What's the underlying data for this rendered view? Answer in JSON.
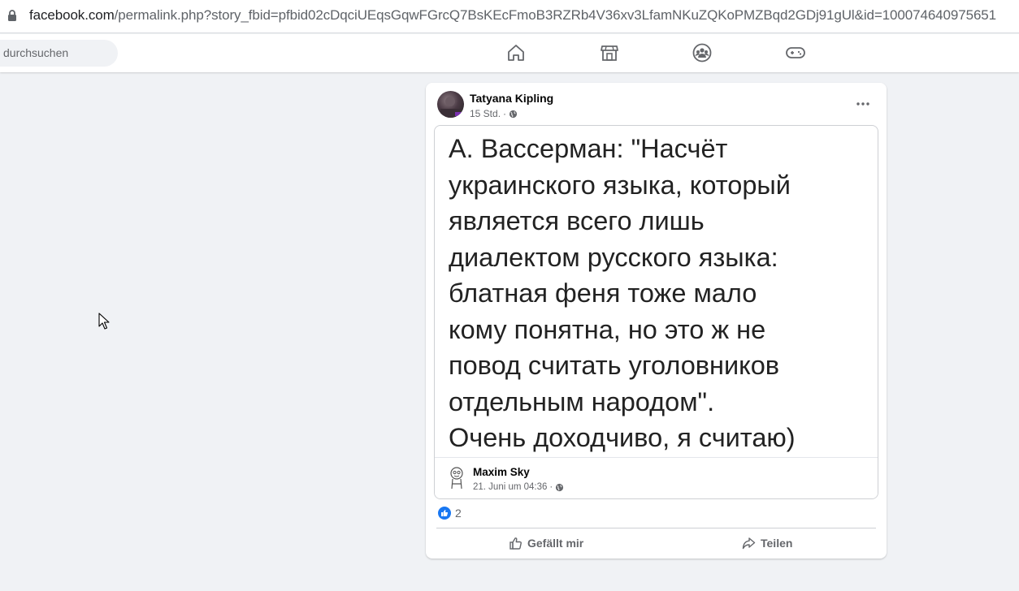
{
  "browser": {
    "url_domain": "facebook.com",
    "url_path": "/permalink.php?story_fbid=pfbid02cDqciUEqsGqwFGrcQ7BsKEcFmoB3RZRb4V36xv3LfamNKuZQKoPMZBqd2GDj91gUl&id=100074640975651"
  },
  "topbar": {
    "search_placeholder": "durchsuchen",
    "nav_icons": [
      "home-icon",
      "marketplace-icon",
      "groups-icon",
      "gaming-icon"
    ]
  },
  "post": {
    "author": "Tatyana Kipling",
    "time": "15 Std.",
    "separator": "·",
    "shared": {
      "lines": [
        "А. Вассерман: \"Насчёт",
        "украинского языка, который",
        "является всего лишь",
        "диалектом русского языка:",
        "блатная феня тоже мало",
        "кому понятна, но это ж не",
        "повод считать уголовников",
        "отдельным народом\".",
        "Очень доходчиво, я считаю)"
      ],
      "author": "Maxim Sky",
      "time": "21. Juni um 04:36",
      "separator": "·"
    },
    "reaction_count": "2",
    "like_label": "Gefällt mir",
    "share_label": "Teilen"
  },
  "colors": {
    "facebook_blue": "#1877f2",
    "background": "#f0f2f5",
    "secondary_text": "#65676b"
  }
}
